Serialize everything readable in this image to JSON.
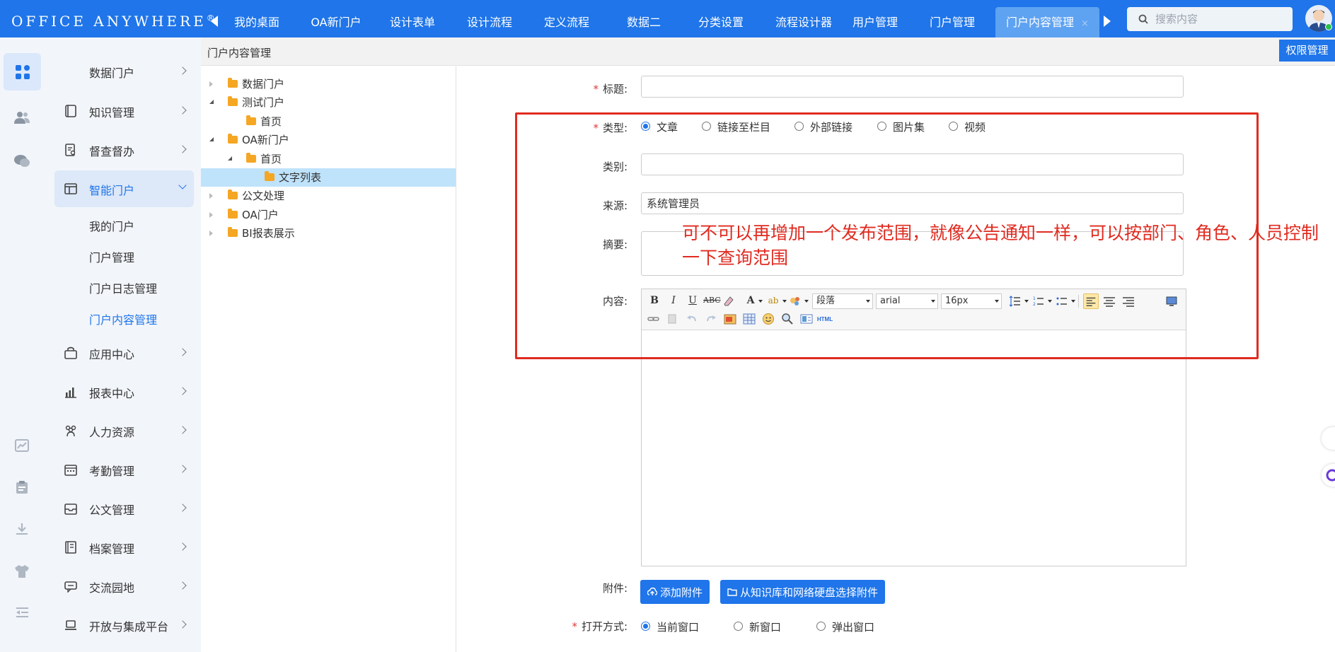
{
  "header": {
    "logo_text": "OFFICE ANYWHERE",
    "logo_mark": "®",
    "tabs": [
      {
        "label": "我的桌面"
      },
      {
        "label": "OA新门户"
      },
      {
        "label": "设计表单"
      },
      {
        "label": "设计流程"
      },
      {
        "label": "定义流程"
      },
      {
        "label": "数据二"
      },
      {
        "label": "分类设置"
      },
      {
        "label": "流程设计器"
      },
      {
        "label": "用户管理"
      },
      {
        "label": "门户管理"
      },
      {
        "label": "门户内容管理",
        "active": true,
        "close": "×"
      }
    ],
    "search_placeholder": "搜索内容"
  },
  "sidebar": {
    "items": [
      {
        "label": "数据门户",
        "icon": "data-portal-icon"
      },
      {
        "label": "知识管理",
        "icon": "book-icon"
      },
      {
        "label": "督查督办",
        "icon": "clipboard-search-icon"
      },
      {
        "label": "智能门户",
        "icon": "layout-icon",
        "active": true
      },
      {
        "label": "应用中心",
        "icon": "bag-icon"
      },
      {
        "label": "报表中心",
        "icon": "bar-chart-icon"
      },
      {
        "label": "人力资源",
        "icon": "people-icon"
      },
      {
        "label": "考勤管理",
        "icon": "calendar-icon"
      },
      {
        "label": "公文管理",
        "icon": "inbox-icon"
      },
      {
        "label": "档案管理",
        "icon": "archive-icon"
      },
      {
        "label": "交流园地",
        "icon": "chat-icon"
      },
      {
        "label": "开放与集成平台",
        "icon": "laptop-icon"
      }
    ],
    "sub_items": [
      {
        "label": "我的门户"
      },
      {
        "label": "门户管理"
      },
      {
        "label": "门户日志管理"
      },
      {
        "label": "门户内容管理",
        "active": true
      }
    ]
  },
  "breadcrumb": {
    "current": "门户内容管理",
    "perm_button": "权限管理"
  },
  "tree": [
    {
      "label": "数据门户",
      "level": 0,
      "state": "closed"
    },
    {
      "label": "测试门户",
      "level": 0,
      "state": "open"
    },
    {
      "label": "首页",
      "level": 1,
      "state": "leaf"
    },
    {
      "label": "OA新门户",
      "level": 0,
      "state": "open"
    },
    {
      "label": "首页",
      "level": 1,
      "state": "open"
    },
    {
      "label": "文字列表",
      "level": 2,
      "state": "leaf",
      "selected": true
    },
    {
      "label": "公文处理",
      "level": 0,
      "state": "closed"
    },
    {
      "label": "OA门户",
      "level": 0,
      "state": "closed"
    },
    {
      "label": "BI报表展示",
      "level": 0,
      "state": "closed"
    }
  ],
  "form": {
    "title_label": "标题:",
    "title_value": "",
    "type_label": "类型:",
    "type_options": [
      {
        "label": "文章",
        "checked": true
      },
      {
        "label": "链接至栏目"
      },
      {
        "label": "外部链接"
      },
      {
        "label": "图片集"
      },
      {
        "label": "视频"
      }
    ],
    "category_label": "类别:",
    "category_value": "",
    "source_label": "来源:",
    "source_value": "系统管理员",
    "summary_label": "摘要:",
    "content_label": "内容:",
    "editor": {
      "paragraph": "段落",
      "font": "arial",
      "size": "16px",
      "html_label": "HTML"
    },
    "attach_label": "附件:",
    "add_attach_button": "添加附件",
    "select_attach_button": "从知识库和网络硬盘选择附件",
    "open_label": "打开方式:",
    "open_options": [
      {
        "label": "当前窗口",
        "checked": true
      },
      {
        "label": "新窗口"
      },
      {
        "label": "弹出窗口"
      }
    ]
  },
  "annotation": {
    "text": "可不可以再增加一个发布范围，就像公告通知一样，可以按部门、角色、人员控制一下查询范围"
  },
  "colors": {
    "primary": "#1f75e9",
    "annotation": "#e02b20",
    "selected_row": "#bfe3fb"
  }
}
